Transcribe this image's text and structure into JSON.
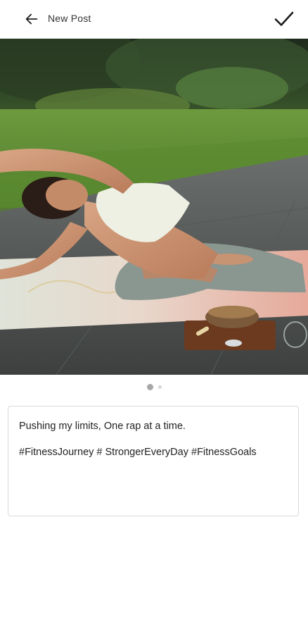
{
  "header": {
    "title": "New Post",
    "back_icon": "arrow-left-icon",
    "confirm_icon": "check-icon"
  },
  "media": {
    "image": "yoga-side-stretch-photo",
    "pager": {
      "total": 2,
      "current": 1
    }
  },
  "caption": {
    "line1": "Pushing my limits, One rap at a time.",
    "line2": "#FitnessJourney # StrongerEveryDay #FitnessGoals"
  }
}
